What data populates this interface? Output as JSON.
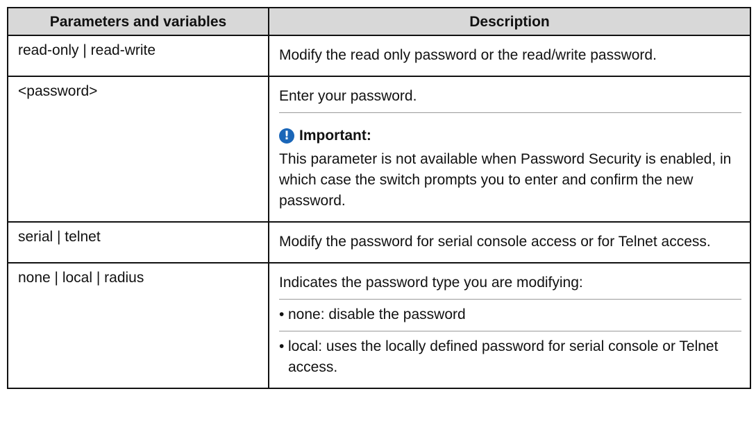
{
  "table": {
    "headers": [
      "Parameters and variables",
      "Description"
    ],
    "rows": [
      {
        "param": "read-only | read-write",
        "description": [
          "Modify the read only password or the read/write password."
        ]
      },
      {
        "param": "<password>",
        "description": [
          "Enter your password."
        ],
        "note": {
          "icon": "exclamation-circle-icon",
          "heading": "Important:",
          "text": "This parameter is not available when Password Security is enabled, in which case the switch prompts you to enter and confirm the new password."
        }
      },
      {
        "param": "serial | telnet",
        "description": [
          "Modify the password for serial console access or for Telnet access."
        ]
      },
      {
        "param": "none | local | radius",
        "description": [
          "Indicates the password type you are modifying:"
        ],
        "bullets": [
          "none: disable the password",
          "local: uses the locally defined password for serial console or Telnet access."
        ]
      }
    ]
  },
  "colors": {
    "header_background": "#d8d8d8",
    "border": "#111111",
    "note_icon": "#1a66b8"
  }
}
